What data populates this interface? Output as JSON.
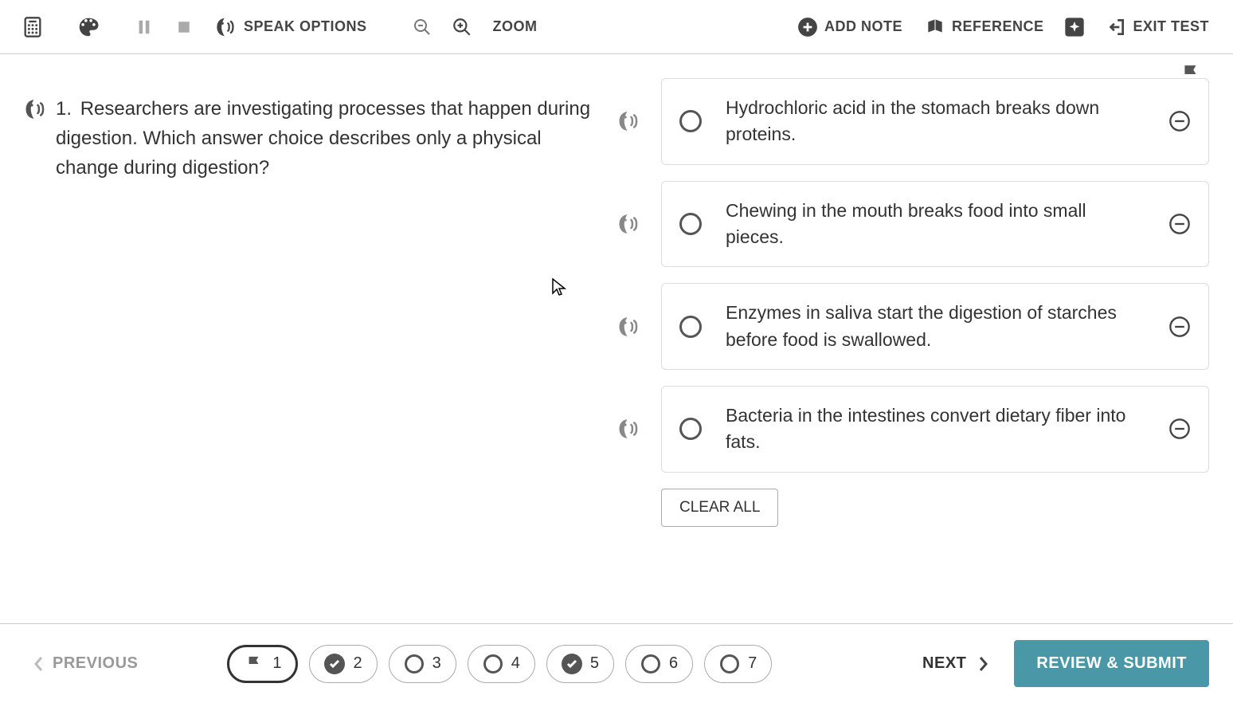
{
  "toolbar": {
    "speak_options": "SPEAK OPTIONS",
    "zoom": "ZOOM",
    "add_note": "ADD NOTE",
    "reference": "REFERENCE",
    "exit_test": "EXIT TEST"
  },
  "question": {
    "number": "1.",
    "text": "Researchers are investigating processes that happen during digestion. Which answer choice describes only a physical change during digestion?"
  },
  "answers": [
    {
      "text": "Hydrochloric acid in the stomach breaks down proteins."
    },
    {
      "text": "Chewing in the mouth breaks food into small pieces."
    },
    {
      "text": "Enzymes in saliva start the digestion of starches before food is swallowed."
    },
    {
      "text": "Bacteria in the intestines convert dietary fiber into fats."
    }
  ],
  "clear_all": "CLEAR ALL",
  "nav": {
    "previous": "PREVIOUS",
    "next": "NEXT",
    "review_submit": "REVIEW & SUBMIT",
    "pills": [
      {
        "num": "1",
        "state": "flag",
        "current": true
      },
      {
        "num": "2",
        "state": "answered",
        "current": false
      },
      {
        "num": "3",
        "state": "empty",
        "current": false
      },
      {
        "num": "4",
        "state": "empty",
        "current": false
      },
      {
        "num": "5",
        "state": "answered",
        "current": false
      },
      {
        "num": "6",
        "state": "empty",
        "current": false
      },
      {
        "num": "7",
        "state": "empty",
        "current": false
      }
    ]
  }
}
